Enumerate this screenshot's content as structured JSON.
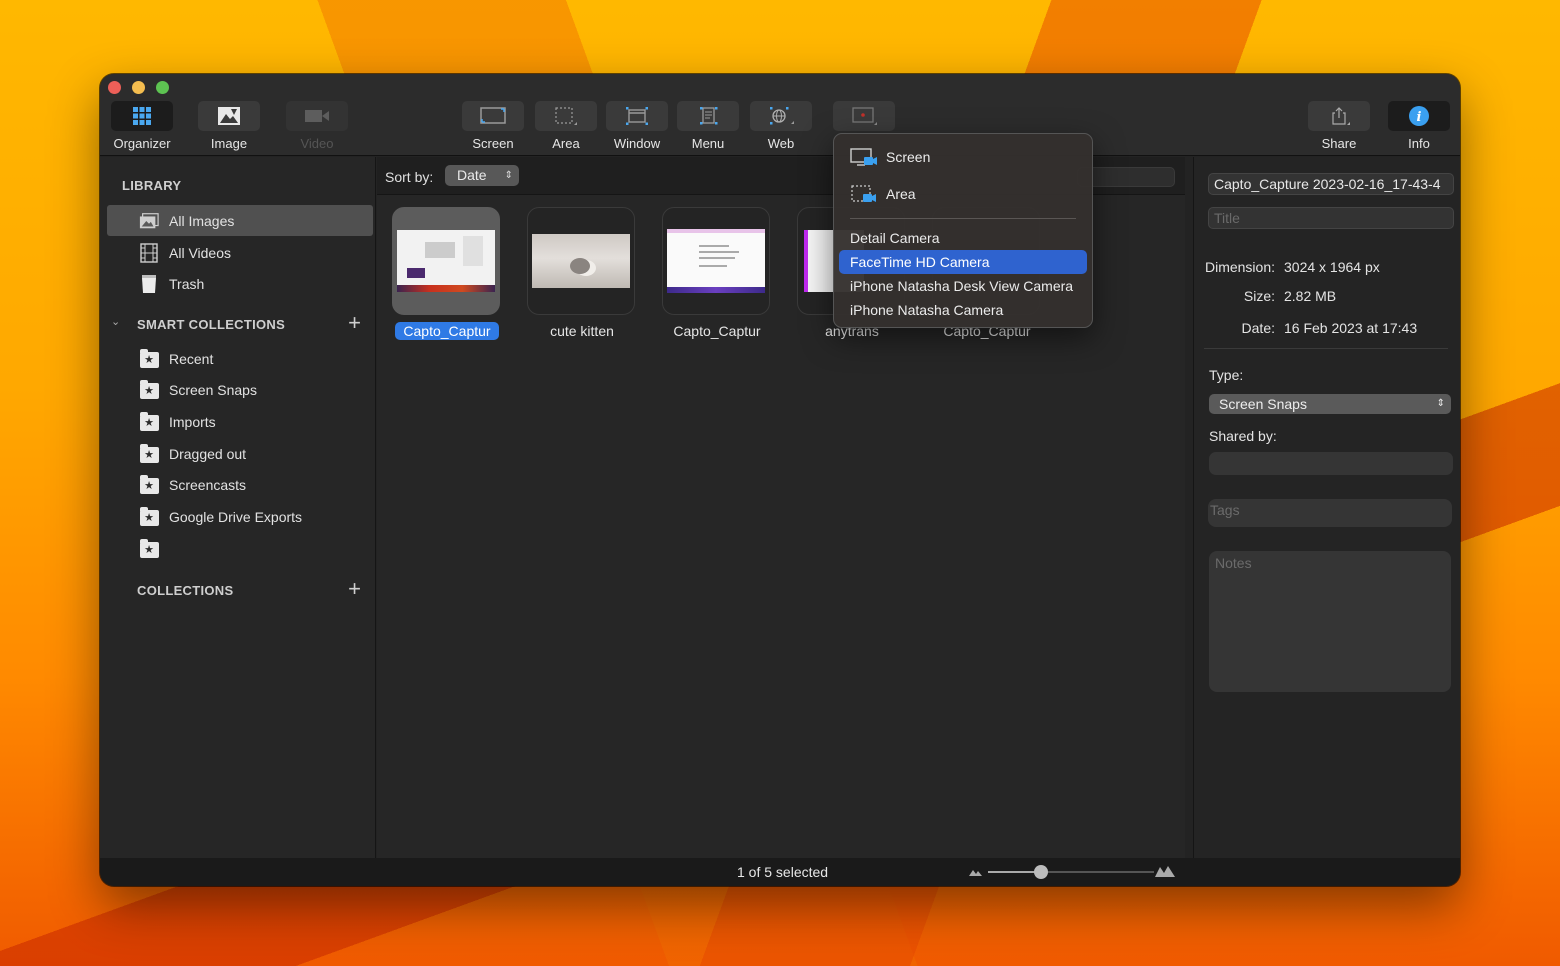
{
  "window": {
    "traffic_lights": [
      "close",
      "minimize",
      "zoom"
    ]
  },
  "toolbar": {
    "left": [
      {
        "id": "organizer",
        "label": "Organizer",
        "icon": "grid-icon",
        "active": true
      },
      {
        "id": "image",
        "label": "Image",
        "icon": "image-icon"
      },
      {
        "id": "video",
        "label": "Video",
        "icon": "video-camera-icon",
        "disabled": true
      }
    ],
    "capture": [
      {
        "id": "screen",
        "label": "Screen",
        "icon": "screen-capture-icon"
      },
      {
        "id": "area",
        "label": "Area",
        "icon": "area-capture-icon"
      },
      {
        "id": "window",
        "label": "Window",
        "icon": "window-capture-icon"
      },
      {
        "id": "menu",
        "label": "Menu",
        "icon": "menu-capture-icon"
      },
      {
        "id": "web",
        "label": "Web",
        "icon": "web-capture-icon"
      },
      {
        "id": "record",
        "label": "",
        "icon": "screen-record-icon"
      }
    ],
    "right": [
      {
        "id": "share",
        "label": "Share",
        "icon": "share-icon"
      },
      {
        "id": "info",
        "label": "Info",
        "icon": "info-icon",
        "active": true
      }
    ]
  },
  "sidebar": {
    "library_heading": "LIBRARY",
    "library": [
      {
        "label": "All Images",
        "icon": "images-icon",
        "selected": true
      },
      {
        "label": "All Videos",
        "icon": "film-icon"
      },
      {
        "label": "Trash",
        "icon": "trash-icon"
      }
    ],
    "smart_heading": "SMART COLLECTIONS",
    "smart": [
      {
        "label": "Recent"
      },
      {
        "label": "Screen Snaps"
      },
      {
        "label": "Imports"
      },
      {
        "label": "Dragged out"
      },
      {
        "label": "Screencasts"
      },
      {
        "label": "Google Drive Exports"
      },
      {
        "label": ""
      }
    ],
    "collections_heading": "COLLECTIONS"
  },
  "main": {
    "sort_label": "Sort by:",
    "sort_value": "Date",
    "thumbnails": [
      {
        "caption": "Capto_Captur",
        "kind": "screen",
        "selected": true
      },
      {
        "caption": "cute kitten",
        "kind": "kitten"
      },
      {
        "caption": "Capto_Captur",
        "kind": "doc"
      },
      {
        "caption": "anytrans",
        "kind": "any"
      },
      {
        "caption": "Capto_Captur",
        "kind": "hidden"
      }
    ]
  },
  "popup_menu": {
    "items": [
      {
        "label": "Screen",
        "icon": "screen-record-icon"
      },
      {
        "label": "Area",
        "icon": "area-record-icon"
      }
    ],
    "cameras": [
      {
        "label": "Detail Camera"
      },
      {
        "label": "FaceTime HD Camera",
        "highlighted": true
      },
      {
        "label": "iPhone Natasha Desk View Camera"
      },
      {
        "label": "iPhone Natasha Camera"
      }
    ]
  },
  "inspector": {
    "filename": "Capto_Capture 2023-02-16_17-43-4",
    "title_placeholder": "Title",
    "dimension_label": "Dimension:",
    "dimension_value": "3024 x 1964 px",
    "size_label": "Size:",
    "size_value": "2.82 MB",
    "date_label": "Date:",
    "date_value": "16 Feb 2023 at 17:43",
    "type_label": "Type:",
    "type_value": "Screen Snaps",
    "shared_label": "Shared by:",
    "shared_value": "",
    "tags_placeholder": "Tags",
    "notes_placeholder": "Notes"
  },
  "statusbar": {
    "selection_text": "1 of 5 selected",
    "thumbnail_zoom": 0.32
  },
  "colors": {
    "accent": "#2f7ae5",
    "menu_highlight": "#2f63cf",
    "info_blue": "#3aa0f0"
  }
}
